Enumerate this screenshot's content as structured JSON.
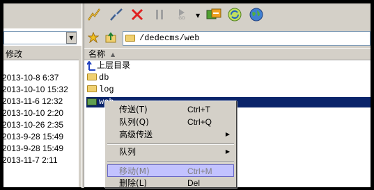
{
  "left_pane": {
    "header_label": "修改",
    "dates": [
      "2013-10-8 6:37",
      "2013-10-10 15:32",
      "2013-11-6 12:32",
      "2013-10-10 2:20",
      "2013-10-26 2:35",
      "2013-9-28 15:49",
      "2013-9-28 15:49",
      "2013-11-7 2:11"
    ]
  },
  "toolbar": {
    "icons": [
      "connect-icon",
      "disconnect-icon",
      "abort-icon",
      "pause-icon",
      "go-icon",
      "dropdown-arrow-icon",
      "sync-browse-icon",
      "refresh-icon",
      "web-globe-icon"
    ],
    "go_label": "GO"
  },
  "address": {
    "path": "/dedecms/web"
  },
  "file_list": {
    "header_name": "名称",
    "sort_indicator": "▲",
    "parent_label": "上层目录",
    "items": [
      "db",
      "log",
      "web"
    ]
  },
  "context_menu": {
    "items": [
      {
        "label": "传送(T)",
        "shortcut": "Ctrl+T"
      },
      {
        "label": "队列(Q)",
        "shortcut": "Ctrl+Q"
      },
      {
        "label": "高级传送",
        "shortcut": ""
      },
      {
        "label": "队列",
        "shortcut": ""
      },
      {
        "label": "移动(M)",
        "shortcut": "Ctrl+M"
      },
      {
        "label": "删除(L)",
        "shortcut": "Del"
      }
    ],
    "submenu_arrow": "▶"
  }
}
